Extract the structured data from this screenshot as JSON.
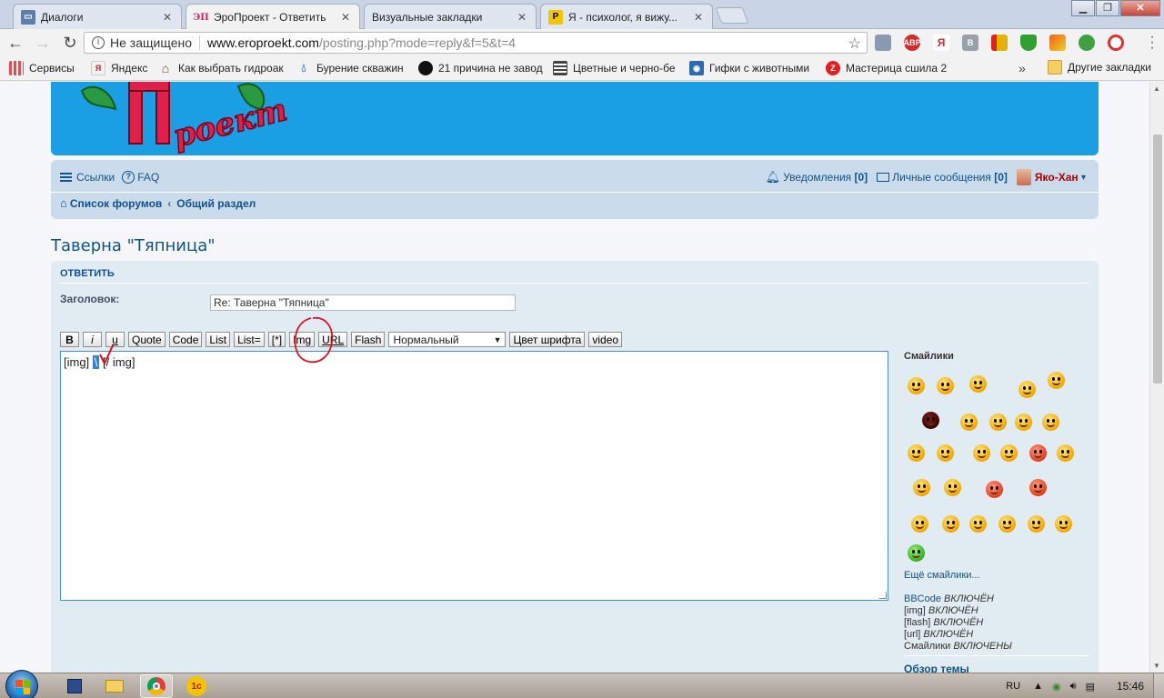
{
  "browser": {
    "tabs": [
      {
        "label": "Диалоги",
        "favicon": "dialog-icon",
        "active": false
      },
      {
        "label": "ЭроПроект - Ответить",
        "favicon": "eroproekt-icon",
        "active": true
      },
      {
        "label": "Визуальные закладки",
        "favicon": "none",
        "active": false
      },
      {
        "label": "Я - психолог, я вижу...",
        "favicon": "yandex-p-icon",
        "active": false
      }
    ],
    "security_text": "Не защищено",
    "url_host": "www.eroproekt.com",
    "url_path": "/posting.php?mode=reply&f=5&t=4",
    "extensions": [
      {
        "name": "puzzle-icon",
        "label": "",
        "color": "#8a9bb0"
      },
      {
        "name": "adblock-icon",
        "label": "ABP",
        "color": "#d42a2a"
      },
      {
        "name": "yandex-icon",
        "label": "Я",
        "color": "#ffffff"
      },
      {
        "name": "vk-icon",
        "label": "B",
        "color": "#9aa0a8"
      },
      {
        "name": "bookmark-red-icon",
        "label": "",
        "color": "#e8b000"
      },
      {
        "name": "shield-icon",
        "label": "",
        "color": "#30a030"
      },
      {
        "name": "gallery-icon",
        "label": "",
        "color": "#f06020"
      },
      {
        "name": "monster-icon",
        "label": "",
        "color": "#40a040"
      },
      {
        "name": "target-icon",
        "label": "",
        "color": "#e03030"
      }
    ],
    "bookmarks": [
      {
        "label": "Сервисы",
        "icon": "apps-grid-icon",
        "color": "#e05050"
      },
      {
        "label": "Яндекс",
        "icon": "yandex-icon",
        "color": "#cc2222"
      },
      {
        "label": "Как выбрать гидроак",
        "icon": "house-icon",
        "color": "#6a4a2a"
      },
      {
        "label": "Бурение скважин",
        "icon": "drop-icon",
        "color": "#2a8ae0"
      },
      {
        "label": "21 причина не завод",
        "icon": "circle-icon",
        "color": "#111111"
      },
      {
        "label": "Цветные и черно-бе",
        "icon": "film-icon",
        "color": "#444444"
      },
      {
        "label": "Гифки с животными",
        "icon": "eye-icon",
        "color": "#2a6ab0"
      },
      {
        "label": "Мастерица сшила 2",
        "icon": "letter-z-icon",
        "color": "#e02020"
      }
    ],
    "bookmarks_more": "»",
    "other_bookmarks": "Другие закладки"
  },
  "nav": {
    "links_label": "Ссылки",
    "faq_label": "FAQ",
    "notifications_label": "Уведомления",
    "notifications_count": "[0]",
    "messages_label": "Личные сообщения",
    "messages_count": "[0]",
    "username": "Яко-Хан",
    "username_caret": "▾",
    "crumb_forums": "Список форумов",
    "crumb_sep": "‹",
    "crumb_section": "Общий раздел"
  },
  "topic_title": "Таверна \"Тяпница\"",
  "form": {
    "heading": "ОТВЕТИТЬ",
    "subject_label": "Заголовок:",
    "subject_value": "Re: Таверна \"Тяпница\"",
    "buttons": {
      "bold": "B",
      "italic": "i",
      "underline": "u",
      "quote": "Quote",
      "code": "Code",
      "list": "List",
      "list_eq": "List=",
      "item": "[*]",
      "img": "Img",
      "url": "URL",
      "flash": "Flash",
      "font_size": "Нормальный",
      "font_color": "Цвет шрифта",
      "video": "video"
    },
    "editor_open_tag": "[img]",
    "editor_selection": "\\",
    "editor_close_tag": "[/ img]"
  },
  "sidebar": {
    "smilies_title": "Смайлики",
    "more_smilies": "Ещё смайлики...",
    "status": [
      {
        "label": "BBCode",
        "state": "ВКЛЮЧЁН"
      },
      {
        "label": "[img]",
        "state": "ВКЛЮЧЁН"
      },
      {
        "label": "[flash]",
        "state": "ВКЛЮЧЁН"
      },
      {
        "label": "[url]",
        "state": "ВКЛЮЧЁН"
      },
      {
        "label": "Смайлики",
        "state": "ВКЛЮЧЕНЫ"
      }
    ],
    "review_label": "Обзор темы"
  },
  "taskbar": {
    "language": "RU",
    "clock": "15:46"
  },
  "colors": {
    "banner": "#1a9ee4",
    "link": "#105289",
    "annotation": "#e0101c"
  }
}
